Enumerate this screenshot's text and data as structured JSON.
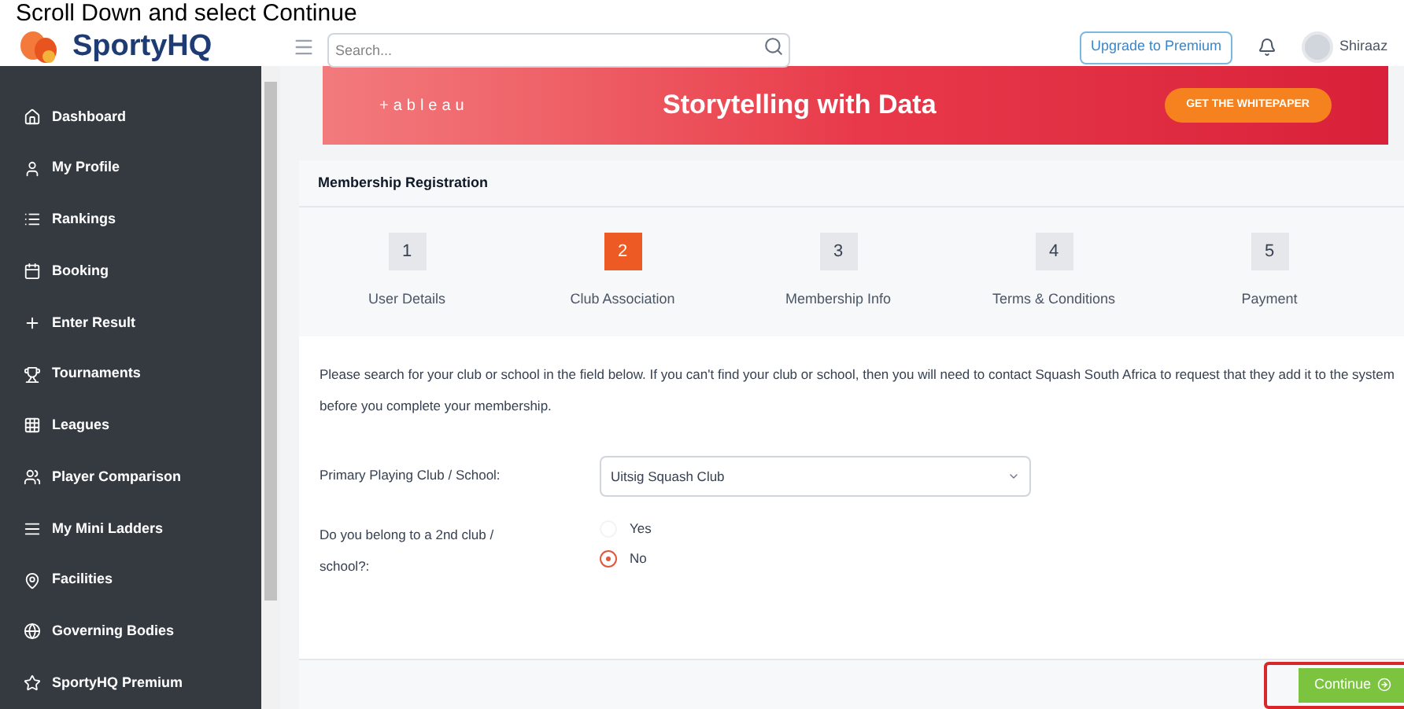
{
  "caption": "Scroll Down and select Continue",
  "header": {
    "logo": "SportyHQ",
    "search_placeholder": "Search...",
    "upgrade": "Upgrade to Premium",
    "user": "Shiraaz"
  },
  "sidebar": {
    "items": [
      {
        "label": "Dashboard",
        "kind": "home"
      },
      {
        "label": "My Profile",
        "kind": "user"
      },
      {
        "label": "Rankings",
        "kind": "list"
      },
      {
        "label": "Booking",
        "kind": "calendar"
      },
      {
        "label": "Enter Result",
        "kind": "plus"
      },
      {
        "label": "Tournaments",
        "kind": "trophy"
      },
      {
        "label": "Leagues",
        "kind": "grid"
      },
      {
        "label": "Player Comparison",
        "kind": "users"
      },
      {
        "label": "My Mini Ladders",
        "kind": "ladder"
      },
      {
        "label": "Facilities",
        "kind": "pin"
      },
      {
        "label": "Governing Bodies",
        "kind": "globe"
      },
      {
        "label": "SportyHQ Premium",
        "kind": "star"
      }
    ]
  },
  "banner": {
    "brand": "+ableau",
    "headline": "Storytelling with Data",
    "cta": "GET THE WHITEPAPER"
  },
  "card": {
    "title": "Membership Registration",
    "steps": [
      {
        "number": "1",
        "label": "User Details",
        "selected": false
      },
      {
        "number": "2",
        "label": "Club Association",
        "selected": true
      },
      {
        "number": "3",
        "label": "Membership Info",
        "selected": false
      },
      {
        "number": "4",
        "label": "Terms & Conditions",
        "selected": false
      },
      {
        "number": "5",
        "label": "Payment",
        "selected": false
      }
    ],
    "intro": "Please search for your club or school in the field below. If you can't find your club or school, then you will need to contact Squash South Africa to request that they add it to the system before you complete your membership.",
    "club_label": "Primary Playing Club / School:",
    "club_value": "Uitsig Squash Club",
    "second_label": "Do you belong to a 2nd club / school?:",
    "second_options": [
      {
        "label": "Yes",
        "selected": false
      },
      {
        "label": "No",
        "selected": true
      }
    ],
    "continue": "Continue"
  }
}
